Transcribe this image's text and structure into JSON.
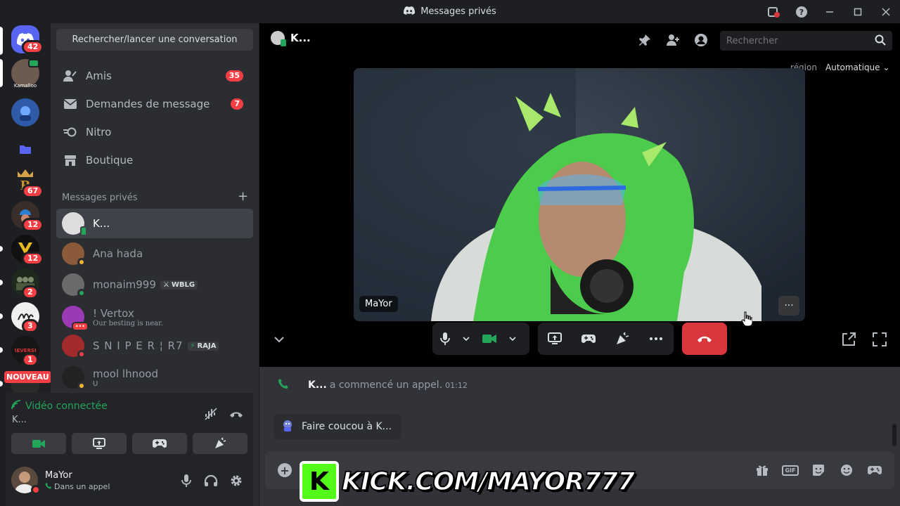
{
  "titlebar": {
    "title": "Messages privés"
  },
  "rail": {
    "home_badge": "42",
    "servers": [
      {
        "badge": ""
      },
      {
        "badge": ""
      },
      {
        "badge": ""
      },
      {
        "badge": "67"
      },
      {
        "badge": "12"
      },
      {
        "badge": "12"
      },
      {
        "badge": "2"
      },
      {
        "badge": "3"
      },
      {
        "badge": "1"
      }
    ],
    "new_label": "NOUVEAU",
    "avatar_caption": "Kamalloo"
  },
  "sidebar": {
    "search_label": "Rechercher/lancer une conversation",
    "nav": [
      {
        "label": "Amis",
        "badge": "35",
        "icon": "friends-icon"
      },
      {
        "label": "Demandes de message",
        "badge": "7",
        "icon": "mail-icon"
      },
      {
        "label": "Nitro",
        "badge": "",
        "icon": "nitro-icon"
      },
      {
        "label": "Boutique",
        "badge": "",
        "icon": "shop-icon"
      }
    ],
    "section_label": "Messages privés",
    "dms": [
      {
        "name": "K...",
        "sub": "",
        "tag": "",
        "active": true
      },
      {
        "name": "Ana hada",
        "sub": "",
        "tag": ""
      },
      {
        "name": "monaim999",
        "sub": "",
        "tag": "WBLG"
      },
      {
        "name": "! Vertox",
        "sub": "Our besting is near.",
        "tag": ""
      },
      {
        "name": "S N I P E R ¦ R7",
        "sub": "",
        "tag": "RAJA"
      },
      {
        "name": "mool lhnood",
        "sub": "U",
        "tag": ""
      }
    ]
  },
  "voice": {
    "status": "Vidéo connectée",
    "channel": "K..."
  },
  "user": {
    "name": "MaYor",
    "status": "Dans un appel"
  },
  "call": {
    "header_name": "K...",
    "search_placeholder": "Rechercher",
    "region_label": "région",
    "region_value": "Automatique",
    "video_name": "MaYor"
  },
  "messages": {
    "caller": "K...",
    "call_text": "a commencé un appel.",
    "call_time": "01:12",
    "wave_label": "Faire coucou à K..."
  },
  "overlay": {
    "logo_letter": "K",
    "text": "KICK.COM/MAYOR777"
  },
  "colors": {
    "accent": "#5865f2",
    "danger": "#da373c",
    "online": "#23a55a",
    "kick_green": "#53fc18"
  }
}
